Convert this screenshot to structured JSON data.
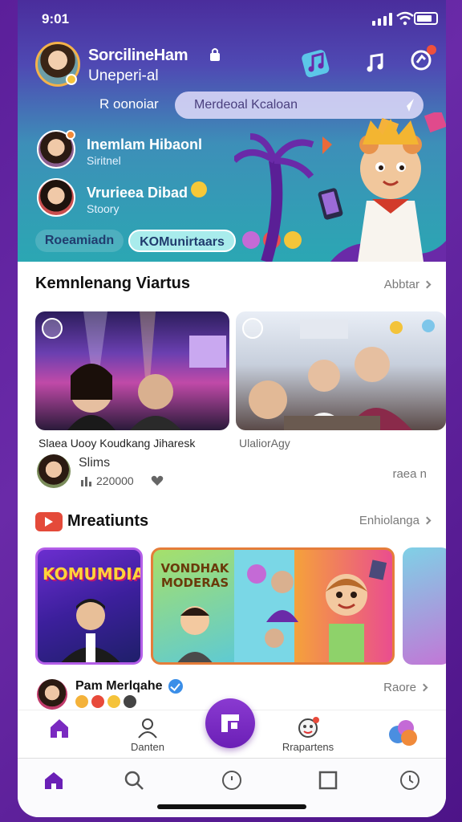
{
  "status_bar": {
    "time": "9:01"
  },
  "profile": {
    "name": "SorcilineHam",
    "subtitle": "Uneperi-al"
  },
  "header_tabs": {
    "left_tab": "R oonoiar",
    "search_placeholder": "Merdeoal Kcaloan"
  },
  "friends": [
    {
      "name": "Inemlam Hibaonl",
      "sub": "Siritnel"
    },
    {
      "name": "Vrurieea Dibad",
      "sub": "Stoory"
    }
  ],
  "chips": [
    "Roeamiadn",
    "KOMunirtaars"
  ],
  "section_1": {
    "title": "Kemnlenang Viartus",
    "link": "Abbtar",
    "captions": [
      "Slaea Uooy  Koudkang Jiharesk",
      "UlaliorAgy"
    ],
    "author_name": "Slims",
    "author_stat": "220000",
    "right_meta": "raea n"
  },
  "section_2": {
    "title": "Mreatiunts",
    "link": "Enhiolanga",
    "tile_a_title": "KOMUMDIAS",
    "tile_b_title": "VONDHAK MODERAS"
  },
  "creator": {
    "name": "Pam Merlqahe",
    "right": "Raore"
  },
  "nav_primary": [
    {
      "label": ""
    },
    {
      "label": "Danten"
    },
    {
      "label": "Rrapartens"
    },
    {
      "label": ""
    }
  ],
  "colors": {
    "brand_purple": "#6b1fb6",
    "header_teal": "#2ba7b3",
    "accent_orange": "#f08a3a"
  },
  "icons": {
    "nav_secondary": [
      "home-icon",
      "search-icon",
      "clock-badge-icon",
      "square-icon",
      "history-icon"
    ]
  }
}
